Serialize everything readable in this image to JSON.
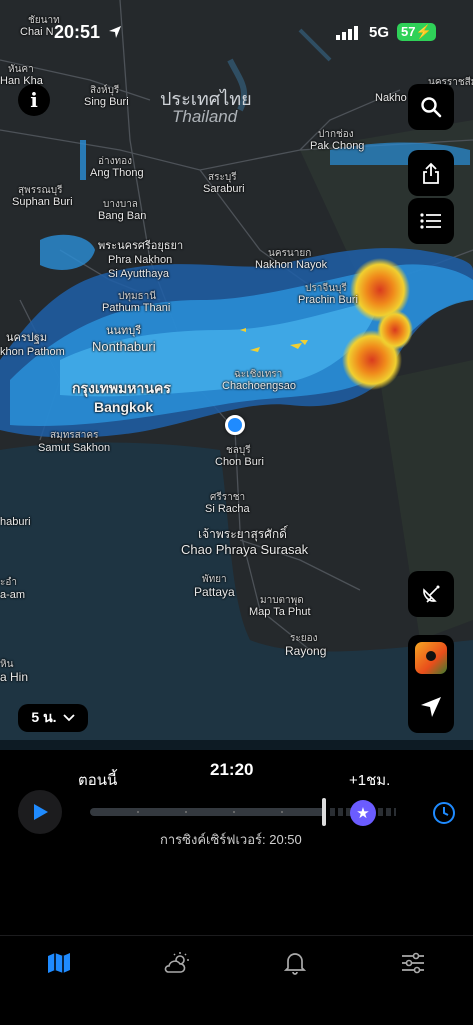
{
  "status_bar": {
    "time": "20:51",
    "network": "5G",
    "battery": "57"
  },
  "map": {
    "country_th": "ประเทศไทย",
    "country_en": "Thailand",
    "places": [
      {
        "id": "chainat-th",
        "text": "ชัยนาท"
      },
      {
        "id": "chainat",
        "text": "Chai N"
      },
      {
        "id": "hankha-th",
        "text": "หันคา"
      },
      {
        "id": "hankha",
        "text": "Han Kha"
      },
      {
        "id": "singburi-th",
        "text": "สิงห์บุรี"
      },
      {
        "id": "singburi",
        "text": "Sing Buri"
      },
      {
        "id": "angthong-th",
        "text": "อ่างทอง"
      },
      {
        "id": "angthong",
        "text": "Ang Thong"
      },
      {
        "id": "suphan-th",
        "text": "สุพรรณบุรี"
      },
      {
        "id": "suphan",
        "text": "Suphan Buri"
      },
      {
        "id": "bangban-th",
        "text": "บางบาล"
      },
      {
        "id": "bangban",
        "text": "Bang Ban"
      },
      {
        "id": "ayutthaya-th",
        "text": "พระนครศรีอยุธยา"
      },
      {
        "id": "ayutthaya1",
        "text": "Phra Nakhon"
      },
      {
        "id": "ayutthaya2",
        "text": "Si Ayutthaya"
      },
      {
        "id": "pathumthani-th",
        "text": "ปทุมธานี"
      },
      {
        "id": "pathumthani",
        "text": "Pathum Thani"
      },
      {
        "id": "nonthaburi-th",
        "text": "นนทบุรี"
      },
      {
        "id": "nonthaburi",
        "text": "Nonthaburi"
      },
      {
        "id": "nakhonpathom-th",
        "text": "นครปฐม"
      },
      {
        "id": "nakhonpathom",
        "text": "khon Pathom"
      },
      {
        "id": "bangkok-th",
        "text": "กรุงเทพมหานคร"
      },
      {
        "id": "bangkok",
        "text": "Bangkok"
      },
      {
        "id": "samutsakhon-th",
        "text": "สมุทรสาคร"
      },
      {
        "id": "samutsakhon",
        "text": "Samut Sakhon"
      },
      {
        "id": "saraburi-th",
        "text": "สระบุรี"
      },
      {
        "id": "saraburi",
        "text": "Saraburi"
      },
      {
        "id": "pakchong-th",
        "text": "ปากช่อง"
      },
      {
        "id": "pakchong",
        "text": "Pak Chong"
      },
      {
        "id": "nakhonnayok-th",
        "text": "นครนายก"
      },
      {
        "id": "nakhonnayok",
        "text": "Nakhon Nayok"
      },
      {
        "id": "prachinburi-th",
        "text": "ปราจีนบุรี"
      },
      {
        "id": "prachinburi",
        "text": "Prachin Buri"
      },
      {
        "id": "chachoengsao-th",
        "text": "ฉะเชิงเทรา"
      },
      {
        "id": "chachoengsao",
        "text": "Chachoengsao"
      },
      {
        "id": "chonburi-th",
        "text": "ชลบุรี"
      },
      {
        "id": "chonburi",
        "text": "Chon Buri"
      },
      {
        "id": "siracha-th",
        "text": "ศรีราชา"
      },
      {
        "id": "siracha",
        "text": "Si Racha"
      },
      {
        "id": "surasak-th",
        "text": "เจ้าพระยาสุรศักดิ์"
      },
      {
        "id": "surasak",
        "text": "Chao Phraya Surasak"
      },
      {
        "id": "pattaya-th",
        "text": "พัทยา"
      },
      {
        "id": "pattaya",
        "text": "Pattaya"
      },
      {
        "id": "maptaphut-th",
        "text": "มาบตาพุด"
      },
      {
        "id": "maptaphut",
        "text": "Map Ta Phut"
      },
      {
        "id": "rayong-th",
        "text": "ระยอง"
      },
      {
        "id": "rayong",
        "text": "Rayong"
      },
      {
        "id": "nakhonrat-th",
        "text": "นครราชสีม"
      },
      {
        "id": "nakhonrat",
        "text": "Nakho    asin"
      },
      {
        "id": "haburi",
        "text": "haburi"
      },
      {
        "id": "aam-th",
        "text": "ะอำ"
      },
      {
        "id": "aam",
        "text": "a-am"
      },
      {
        "id": "huahin-th",
        "text": "หิน"
      },
      {
        "id": "huahin",
        "text": "a Hin"
      }
    ]
  },
  "controls": {
    "info_label": "i",
    "range_label": "5 น."
  },
  "timeline": {
    "now_label": "ตอนนี้",
    "current_time": "21:20",
    "plus_label": "+1ชม.",
    "sync_label": "การซิงค์เซิร์ฟเวอร์: 20:50",
    "progress": 0.78
  },
  "colors": {
    "accent": "#1f8bff",
    "battery": "#2fd158",
    "star": "#6b5cff"
  },
  "icons": {
    "search": "search-icon",
    "share": "share-icon",
    "list": "list-icon",
    "satellite": "satellite-icon",
    "layer": "layer-thumbnail",
    "locate": "location-arrow-icon",
    "play": "play-icon",
    "star": "star-icon",
    "clock": "clock-icon",
    "tab_map": "map-icon",
    "tab_weather": "weather-icon",
    "tab_bell": "bell-icon",
    "tab_settings": "sliders-icon"
  }
}
